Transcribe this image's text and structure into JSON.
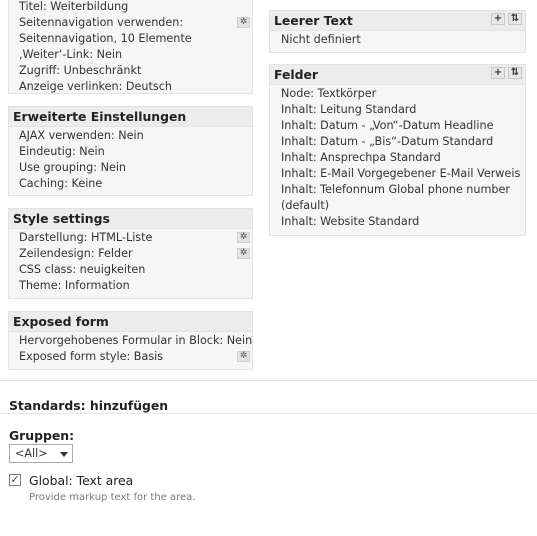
{
  "left_panels": {
    "basic": {
      "rows": [
        "Titel: Weiterbildung",
        "Seitennavigation verwenden:",
        "Seitennavigation, 10 Elemente",
        "‚Weiter‘-Link: Nein",
        "Zugriff: Unbeschränkt",
        "Anzeige verlinken: Deutsch"
      ]
    },
    "advanced": {
      "title": "Erweiterte Einstellungen",
      "rows": [
        "AJAX verwenden: Nein",
        "Eindeutig: Nein",
        "Use grouping: Nein",
        "Caching: Keine"
      ]
    },
    "style": {
      "title": "Style settings",
      "rows": [
        "Darstellung: HTML-Liste",
        "Zeilendesign: Felder",
        "CSS class: neuigkeiten",
        "Theme: Information"
      ]
    },
    "exposed": {
      "title": "Exposed form",
      "rows": [
        "Hervorgehobenes Formular in Block: Nein",
        "Exposed form style: Basis"
      ]
    }
  },
  "right_panels": {
    "empty_text": {
      "title": "Leerer Text",
      "rows": [
        "Nicht definiert"
      ]
    },
    "fields": {
      "title": "Felder",
      "rows": [
        "Node: Textkörper",
        "Inhalt: Leitung Standard",
        "Inhalt: Datum - „Von“-Datum Headline",
        "Inhalt: Datum - „Bis“-Datum Standard",
        "Inhalt: Ansprechpa Standard",
        "Inhalt: E-Mail Vorgegebener E-Mail Verweis",
        "Inhalt: Telefonnum Global phone number (default)",
        "Inhalt: Website Standard"
      ]
    }
  },
  "toolbar": {
    "add_symbol": "+",
    "sort_symbol": "⇅",
    "gear_symbol": "✲"
  },
  "add_section": {
    "title": "Standards: hinzufügen",
    "groups_label": "Gruppen:",
    "groups_selected": "<All>",
    "item_label": "Global: Text area",
    "item_description": "Provide markup text for the area.",
    "item_checked": true
  }
}
